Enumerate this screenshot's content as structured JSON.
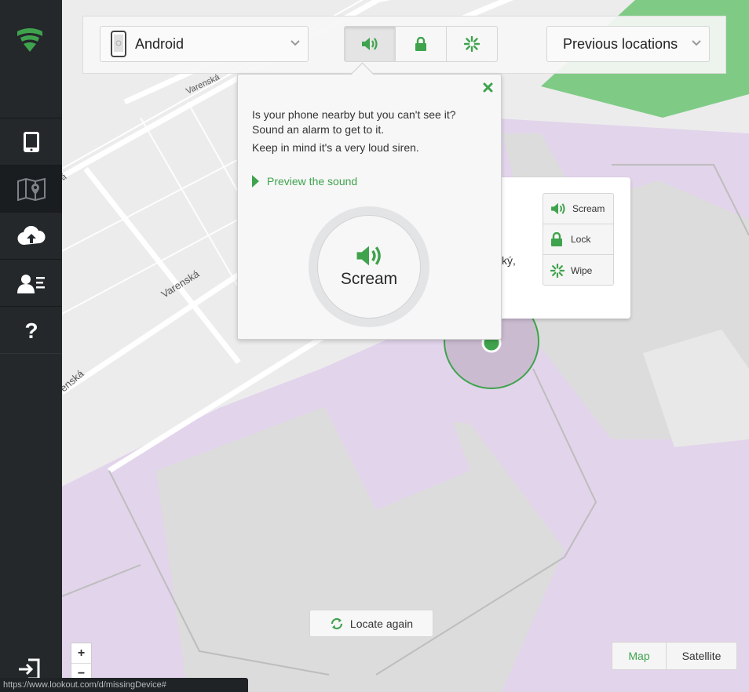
{
  "toolbar": {
    "device_name": "Android",
    "previous_locations_label": "Previous locations",
    "actions": [
      "scream",
      "lock",
      "wipe"
    ]
  },
  "popover": {
    "line1": "Is your phone nearby but you can't see it?",
    "line2": "Sound an alarm to get to it.",
    "line3": "Keep in mind it's a very loud siren.",
    "preview_label": "Preview the sound",
    "scream_label": "Scream"
  },
  "card": {
    "address_fragment": "zský,",
    "scream_label": "Scream",
    "lock_label": "Lock",
    "wipe_label": "Wipe"
  },
  "map": {
    "street_labels": [
      "Varenská",
      "Varenská",
      "enská",
      "á"
    ],
    "locate_again_label": "Locate again",
    "zoom_in": "+",
    "zoom_out": "−",
    "map_tab": "Map",
    "satellite_tab": "Satellite"
  },
  "status_bar": {
    "url": "https://www.lookout.com/d/missingDevice#"
  },
  "colors": {
    "accent_green": "#3fa34d",
    "sidebar_bg": "#24282b",
    "map_park": "#7fcb86",
    "map_building": "#e2d4eb"
  }
}
